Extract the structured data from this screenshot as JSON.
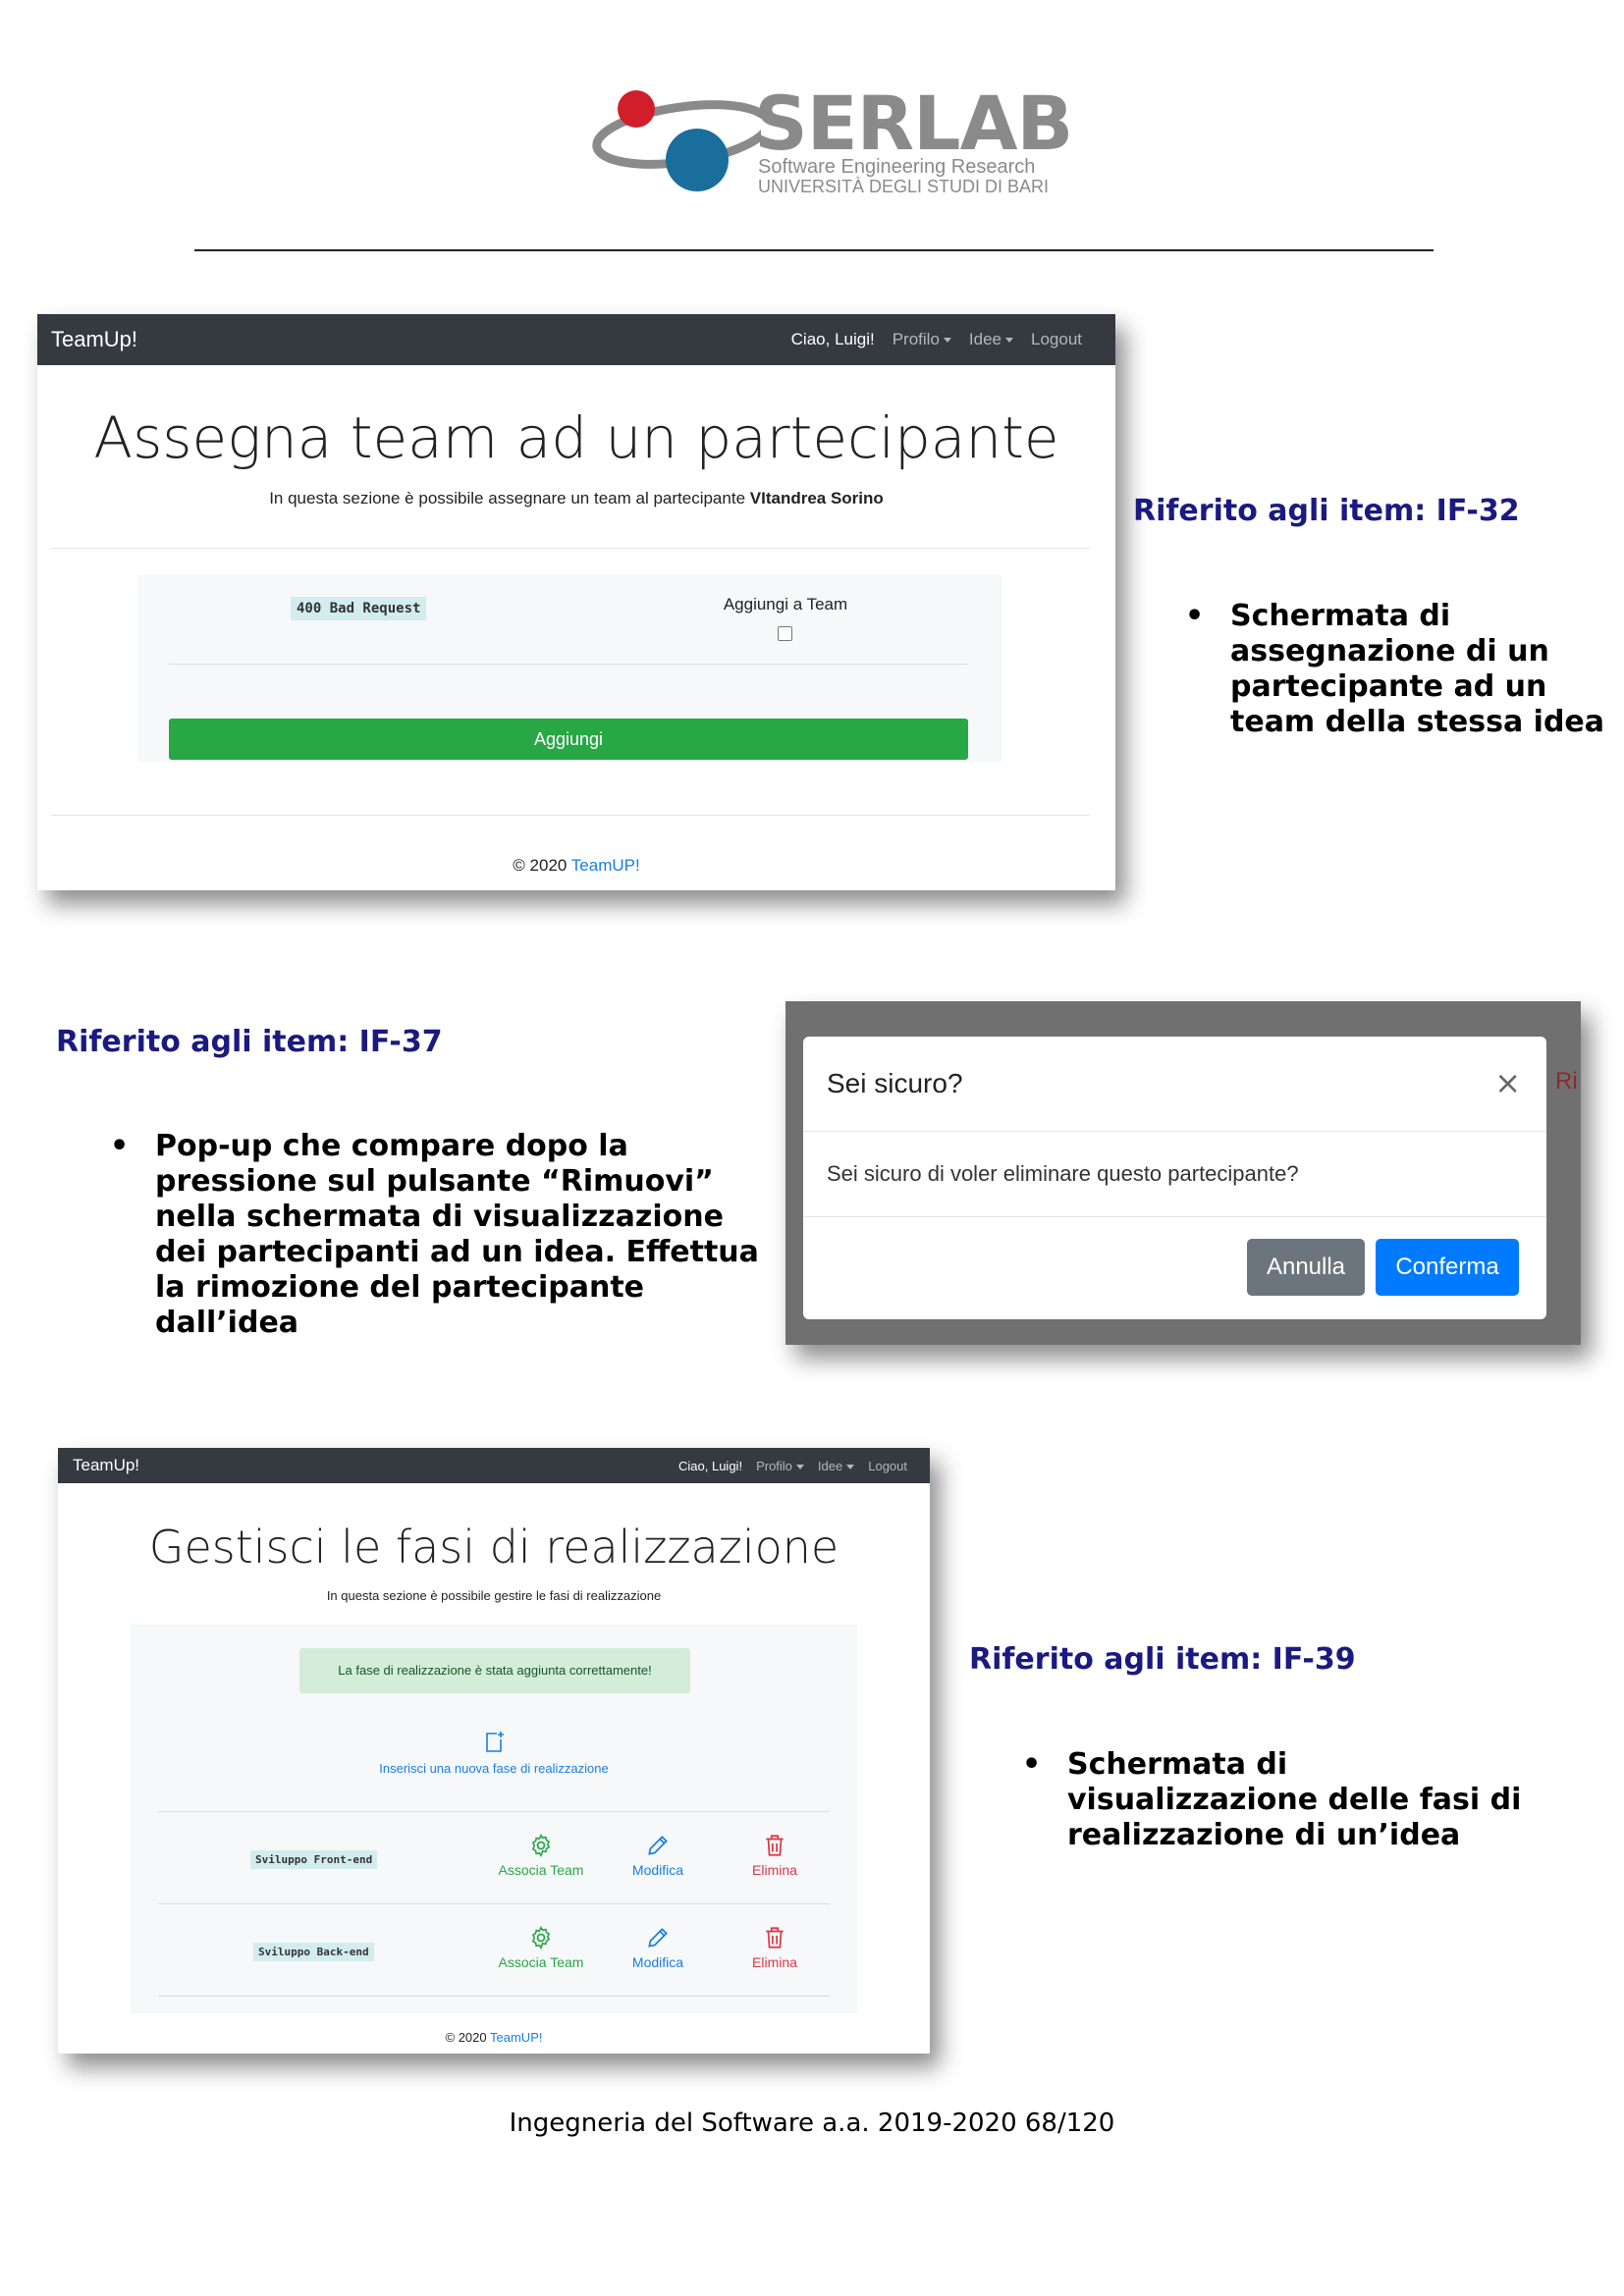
{
  "logo": {
    "word": "SERLAB",
    "sub1": "Software Engineering Research",
    "sub2": "UNIVERSITÀ DEGLI STUDI DI BARI"
  },
  "shot1": {
    "nav": {
      "brand": "TeamUp!",
      "greeting": "Ciao, Luigi!",
      "profilo": "Profilo",
      "idee": "Idee",
      "logout": "Logout"
    },
    "title": "Assegna team ad un partecipante",
    "subtitle": "In questa sezione è possibile assegnare un team al partecipante",
    "subtitle_name": "VItandrea Sorino",
    "badge": "400 Bad Request",
    "checkbox_label": "Aggiungi a Team",
    "button": "Aggiungi",
    "footer_prefix": "© 2020",
    "footer_link": "TeamUP!"
  },
  "caption1": {
    "ref": "Riferito agli item: IF-32",
    "bullet": "Schermata di assegnazione di un partecipante ad un team della stessa idea"
  },
  "caption2": {
    "ref": "Riferito agli item: IF-37",
    "bullet": "Pop-up che compare dopo la pressione sul pulsante “Rimuovi” nella schermata di visualizzazione dei partecipanti ad un idea. Effettua la rimozione del partecipante dall’idea"
  },
  "modal": {
    "title": "Sei sicuro?",
    "close": "×",
    "body": "Sei sicuro di voler eliminare questo partecipante?",
    "cancel": "Annulla",
    "confirm": "Conferma",
    "bg_fragment_right": "Ri",
    "colors": {
      "confirm": "#007bff",
      "cancel": "#6c757d"
    }
  },
  "shot3": {
    "nav": {
      "brand": "TeamUp!",
      "greeting": "Ciao, Luigi!",
      "profilo": "Profilo",
      "idee": "Idee",
      "logout": "Logout"
    },
    "title": "Gestisci le fasi di realizzazione",
    "subtitle": "In questa sezione è possibile gestire le fasi di realizzazione",
    "alert": "La fase di realizzazione è stata aggiunta correttamente!",
    "add_link": "Inserisci una nuova fase di realizzazione",
    "phases": [
      {
        "name": "Sviluppo Front-end",
        "assoc": "Associa Team",
        "edit": "Modifica",
        "delete": "Elimina"
      },
      {
        "name": "Sviluppo Back-end",
        "assoc": "Associa Team",
        "edit": "Modifica",
        "delete": "Elimina"
      }
    ],
    "footer_prefix": "© 2020",
    "footer_link": "TeamUP!"
  },
  "caption3": {
    "ref": "Riferito agli item: IF-39",
    "bullet": "Schermata di visualizzazione delle fasi di realizzazione di un’idea"
  },
  "page_footer": "Ingegneria del Software a.a. 2019-2020 68/120"
}
